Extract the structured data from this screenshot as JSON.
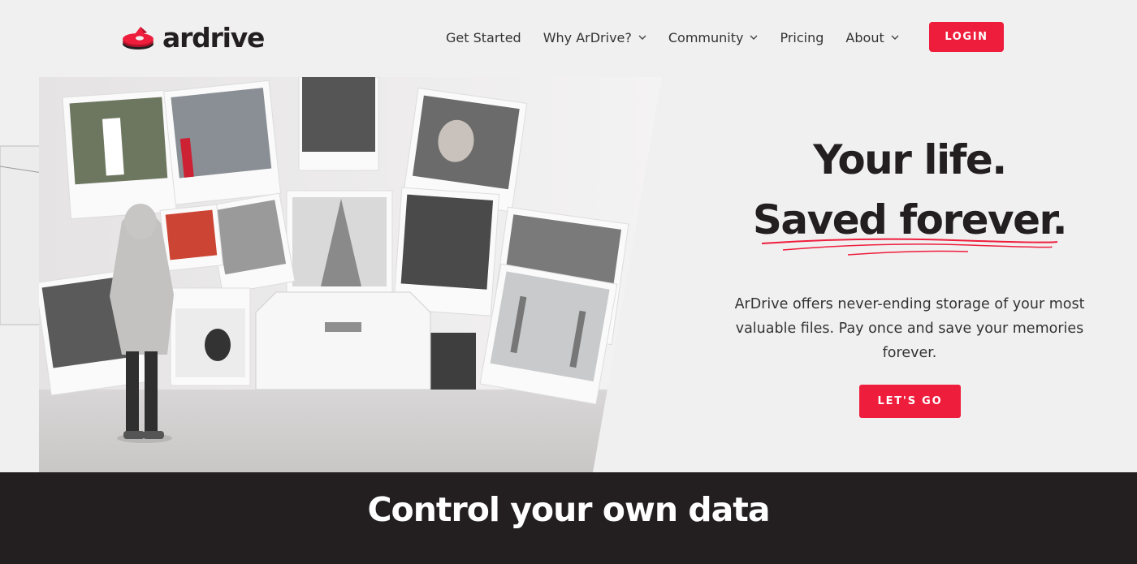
{
  "brand": {
    "name": "ardrive",
    "accent_color": "#ee1d3c",
    "dark_color": "#231f20",
    "logo_icon": "ardrive-logo-icon"
  },
  "nav": {
    "items": [
      {
        "label": "Get Started",
        "has_dropdown": false
      },
      {
        "label": "Why ArDrive?",
        "has_dropdown": true
      },
      {
        "label": "Community",
        "has_dropdown": true
      },
      {
        "label": "Pricing",
        "has_dropdown": false
      },
      {
        "label": "About",
        "has_dropdown": true
      }
    ],
    "login_label": "LOGIN"
  },
  "hero": {
    "headline_line1": "Your life.",
    "headline_line2": "Saved forever.",
    "description": "ArDrive offers never-ending storage of your most valuable files. Pay once and save your memories forever.",
    "cta_label": "LET'S GO",
    "image": "gallery-of-polaroid-photos"
  },
  "section": {
    "title": "Control your own data"
  }
}
